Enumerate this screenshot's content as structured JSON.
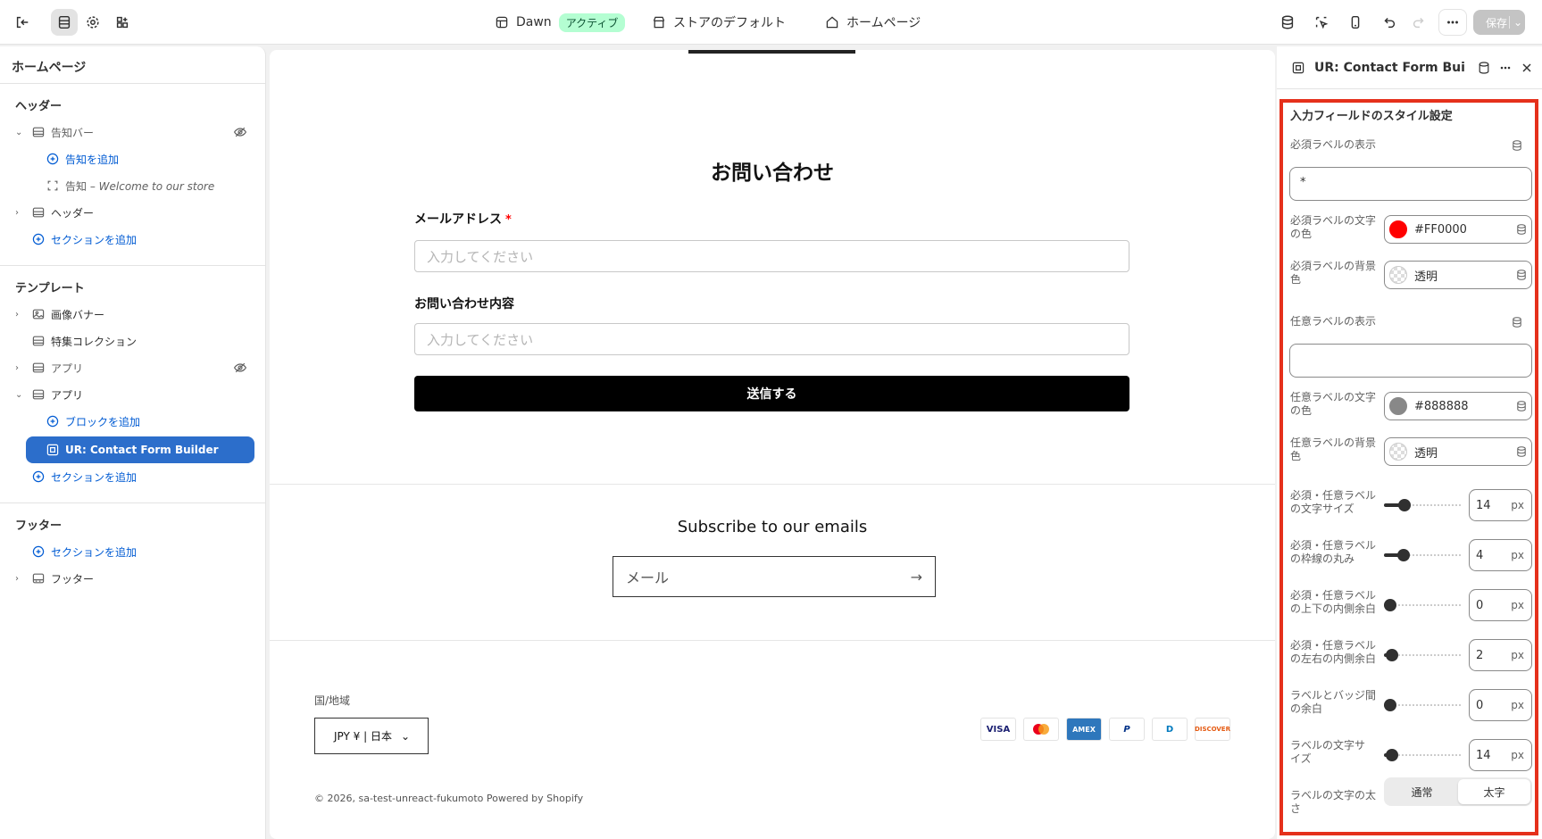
{
  "topbar": {
    "theme_name": "Dawn",
    "theme_badge": "アクティブ",
    "store_default": "ストアのデフォルト",
    "page": "ホームページ",
    "save": "保存"
  },
  "sidebar": {
    "title": "ホームページ",
    "header_group": "ヘッダー",
    "announce_bar": "告知バー",
    "add_announce": "告知を追加",
    "announce_prefix": "告知 – ",
    "announce_text": "Welcome to our store",
    "header": "ヘッダー",
    "add_section_1": "セクションを追加",
    "template_group": "テンプレート",
    "image_banner": "画像バナー",
    "featured_collection": "特集コレクション",
    "app_1": "アプリ",
    "app_2": "アプリ",
    "add_block": "ブロックを追加",
    "selected_block": "UR: Contact Form Builder",
    "add_section_2": "セクションを追加",
    "footer_group": "フッター",
    "add_section_3": "セクションを追加",
    "footer": "フッター"
  },
  "preview": {
    "form_title": "お問い合わせ",
    "email_label": "メールアドレス",
    "required_mark": "*",
    "email_placeholder": "入力してください",
    "message_label": "お問い合わせ内容",
    "message_placeholder": "入力してください",
    "submit": "送信する",
    "subscribe_title": "Subscribe to our emails",
    "subscribe_placeholder": "メール",
    "country_label": "国/地域",
    "country_value": "JPY ¥ | 日本",
    "payments": [
      "VISA",
      "MC",
      "AMEX",
      "P",
      "D",
      "DISCOVER"
    ],
    "copyright": "© 2026, sa-test-unreact-fukumoto Powered by Shopify"
  },
  "panel": {
    "title": "UR: Contact Form Buil...",
    "section_title": "入力フィールドのスタイル設定",
    "req_label_display": "必須ラベルの表示",
    "req_label_value": "*",
    "req_text_color_label": "必須ラベルの文字の色",
    "req_text_color": "#FF0000",
    "req_bg_label": "必須ラベルの背景色",
    "req_bg_value": "透明",
    "opt_label_display": "任意ラベルの表示",
    "opt_label_value": "",
    "opt_text_color_label": "任意ラベルの文字の色",
    "opt_text_color": "#888888",
    "opt_bg_label": "任意ラベルの背景色",
    "opt_bg_value": "透明",
    "unit": "px",
    "sliders": [
      {
        "label": "必須・任意ラベルの文字サイズ",
        "value": "14",
        "level": 0.22
      },
      {
        "label": "必須・任意ラベルの枠線の丸み",
        "value": "4",
        "level": 0.2
      },
      {
        "label": "必須・任意ラベルの上下の内側余白",
        "value": "0",
        "level": 0.0
      },
      {
        "label": "必須・任意ラベルの左右の内側余白",
        "value": "2",
        "level": 0.03
      },
      {
        "label": "ラベルとバッジ間の余白",
        "value": "0",
        "level": 0.0
      },
      {
        "label": "ラベルの文字サイズ",
        "value": "14",
        "level": 0.03
      }
    ],
    "weight_label": "ラベルの文字の太さ",
    "weight_normal": "通常",
    "weight_bold": "太字"
  }
}
